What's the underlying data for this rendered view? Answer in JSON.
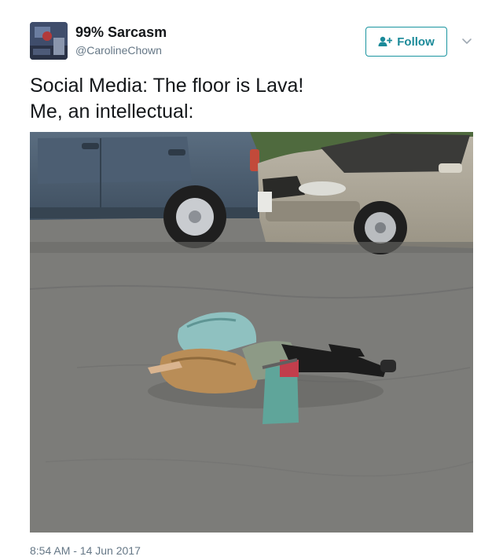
{
  "user": {
    "display_name": "99% Sarcasm",
    "handle": "@CarolineChown"
  },
  "follow_button": {
    "label": "Follow",
    "icon": "add-user-icon"
  },
  "menu": {
    "icon": "chevron-down-icon"
  },
  "tweet": {
    "lines": [
      "Social Media: The floor is Lava!",
      "Me, an intellectual:"
    ],
    "timestamp": "8:54 AM - 14 Jun 2017"
  },
  "colors": {
    "accent": "#1b8a99",
    "text": "#14171a",
    "secondary_text": "#657786"
  }
}
